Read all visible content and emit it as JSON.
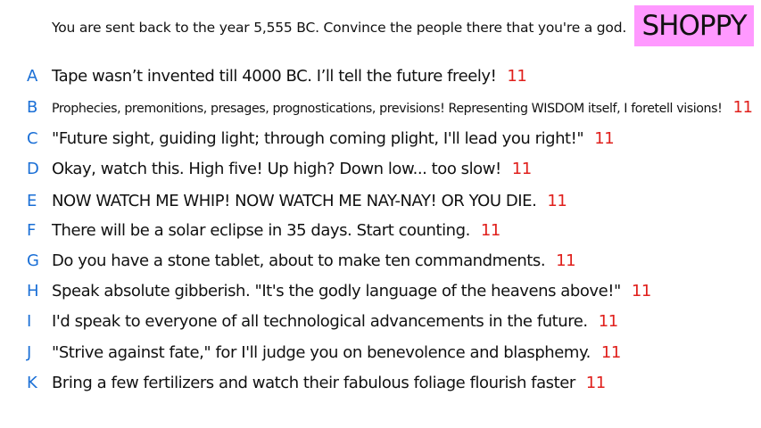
{
  "prompt": "You are sent back to the year 5,555 BC. Convince the people there that you're a god.",
  "brand": "SHOPPY",
  "colors": {
    "letter": "#1a6fd6",
    "score": "#e0201c",
    "badge": "#ff99ff"
  },
  "answers": [
    {
      "letter": "A",
      "text": "Tape wasn’t invented till 4000 BC. I’ll tell the future freely!",
      "score": "11"
    },
    {
      "letter": "B",
      "text": "Prophecies, premonitions, presages, prognostications, previsions! Representing WISDOM itself, I foretell visions!",
      "score": "11"
    },
    {
      "letter": "C",
      "text": "\"Future sight, guiding light; through coming plight, I'll lead you right!\"",
      "score": "11"
    },
    {
      "letter": "D",
      "text": "Okay, watch this. High five! Up high? Down low... too slow!",
      "score": "11"
    },
    {
      "letter": "E",
      "text": "NOW WATCH ME WHIP! NOW WATCH ME NAY-NAY! OR YOU DIE.",
      "score": "11"
    },
    {
      "letter": "F",
      "text": "There will be a solar eclipse in 35 days. Start counting.",
      "score": "11"
    },
    {
      "letter": "G",
      "text": "Do you have a stone tablet, about to make ten commandments.",
      "score": "11"
    },
    {
      "letter": "H",
      "text": "Speak absolute gibberish. \"It's the godly language of the heavens above!\"",
      "score": "11"
    },
    {
      "letter": "I",
      "text": "I'd speak to everyone of all technological advancements in the future.",
      "score": "11"
    },
    {
      "letter": "J",
      "text": "\"Strive against fate,\" for I'll judge you on benevolence and blasphemy.",
      "score": "11"
    },
    {
      "letter": "K",
      "text": "Bring a few fertilizers and watch their fabulous foliage flourish faster",
      "score": "11"
    }
  ]
}
